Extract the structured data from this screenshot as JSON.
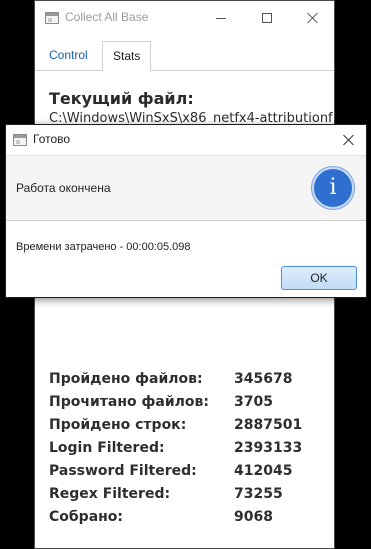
{
  "window": {
    "title": "Collect All Base",
    "tabs": [
      {
        "label": "Control"
      },
      {
        "label": "Stats"
      }
    ]
  },
  "stats_panel": {
    "current_file_heading": "Текущий файл:",
    "current_file_path": "C:\\Windows\\WinSxS\\x86_netfx4-attributionf",
    "rows": [
      {
        "label": "Пройдено файлов:",
        "value": "345678"
      },
      {
        "label": "Прочитано файлов:",
        "value": "3705"
      },
      {
        "label": "Пройдено строк:",
        "value": "2887501"
      },
      {
        "label": "Login Filtered:",
        "value": "2393133"
      },
      {
        "label": "Password Filtered:",
        "value": "412045"
      },
      {
        "label": "Regex Filtered:",
        "value": "73255"
      },
      {
        "label": "Собрано:",
        "value": "9068"
      }
    ]
  },
  "dialog": {
    "title": "Готово",
    "message": "Работа окончена",
    "body": "Времени затрачено - 00:00:05.098",
    "ok_label": "OK",
    "icon": "info-icon",
    "icon_glyph": "i"
  },
  "colors": {
    "accent": "#2f6fd0",
    "tab_link": "#1a5fb4",
    "ok_button_border": "#4a90d9"
  }
}
